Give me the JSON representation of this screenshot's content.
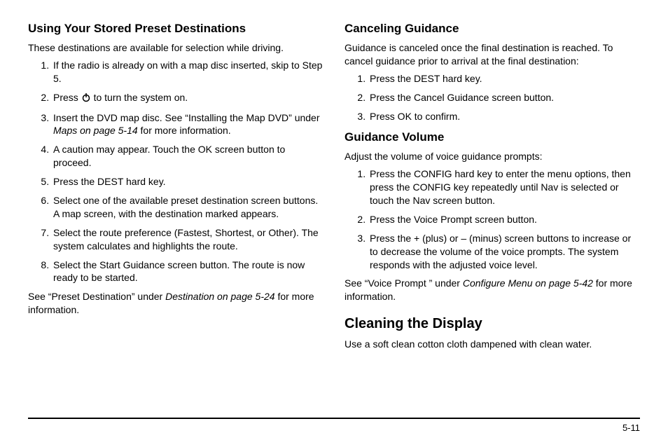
{
  "left": {
    "h1": "Using Your Stored Preset Destinations",
    "intro": "These destinations are available for selection while driving.",
    "steps": {
      "s1": "If the radio is already on with a map disc inserted, skip to Step 5.",
      "s2_before": "Press ",
      "s2_after": " to turn the system on.",
      "s3_before": "Insert the DVD map disc. See “Installing the Map DVD” under ",
      "s3_italic": "Maps on page 5‑14",
      "s3_after": " for more information.",
      "s4": "A caution may appear. Touch the OK screen button to proceed.",
      "s5": "Press the DEST hard key.",
      "s6": "Select one of the available preset destination screen buttons. A map screen, with the destination marked appears.",
      "s7": "Select the route preference (Fastest, Shortest, or Other). The system calculates and highlights the route.",
      "s8": "Select the Start Guidance screen button. The route is now ready to be started."
    },
    "outro_before": "See “Preset Destination” under ",
    "outro_italic": "Destination on page 5‑24",
    "outro_after": " for more information."
  },
  "right": {
    "cancel_h": "Canceling Guidance",
    "cancel_intro": "Guidance is canceled once the final destination is reached. To cancel guidance prior to arrival at the final destination:",
    "cancel_steps": {
      "c1": "Press the DEST hard key.",
      "c2": "Press the Cancel Guidance screen button.",
      "c3": "Press OK to confirm."
    },
    "vol_h": "Guidance Volume",
    "vol_intro": "Adjust the volume of voice guidance prompts:",
    "vol_steps": {
      "v1": "Press the CONFIG hard key to enter the menu options, then press the CONFIG key repeatedly until Nav is selected or touch the Nav screen button.",
      "v2": "Press the Voice Prompt screen button.",
      "v3": "Press the + (plus) or – (minus) screen buttons to increase or to decrease the volume of the voice prompts. The system responds with the adjusted voice level."
    },
    "vol_outro_before": "See “Voice Prompt ” under ",
    "vol_outro_italic": "Configure Menu on page 5‑42",
    "vol_outro_after": " for more information.",
    "clean_h": "Cleaning the Display",
    "clean_p": "Use a soft clean cotton cloth dampened with clean water."
  },
  "page_number": "5-11"
}
